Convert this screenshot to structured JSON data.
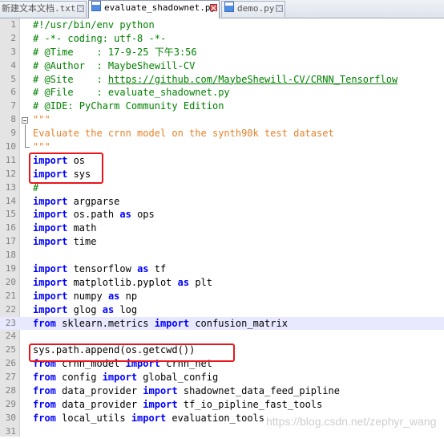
{
  "tabs": [
    {
      "label": "新建文本文档.txt",
      "active": false
    },
    {
      "label": "evaluate_shadownet.py",
      "active": true
    },
    {
      "label": "demo.py",
      "active": false
    }
  ],
  "lines": [
    {
      "n": "1",
      "tokens": [
        [
          "c-comment",
          "#!/usr/bin/env python"
        ]
      ]
    },
    {
      "n": "2",
      "tokens": [
        [
          "c-comment",
          "# -*- coding: utf-8 -*-"
        ]
      ]
    },
    {
      "n": "3",
      "tokens": [
        [
          "c-comment",
          "# @Time    : 17-9-25 下午3:56"
        ]
      ]
    },
    {
      "n": "4",
      "tokens": [
        [
          "c-comment",
          "# @Author  : MaybeShewill-CV"
        ]
      ]
    },
    {
      "n": "5",
      "tokens": [
        [
          "c-comment",
          "# @Site    : "
        ],
        [
          "c-link",
          "https://github.com/MaybeShewill-CV/CRNN_Tensorflow"
        ]
      ]
    },
    {
      "n": "6",
      "tokens": [
        [
          "c-comment",
          "# @File    : evaluate_shadownet.py"
        ]
      ]
    },
    {
      "n": "7",
      "tokens": [
        [
          "c-comment",
          "# @IDE: PyCharm Community Edition"
        ]
      ]
    },
    {
      "n": "8",
      "tokens": [
        [
          "c-string",
          "\"\"\""
        ]
      ]
    },
    {
      "n": "9",
      "tokens": [
        [
          "c-string",
          "Evaluate the crnn model on the synth90k test dataset"
        ]
      ]
    },
    {
      "n": "10",
      "tokens": [
        [
          "c-string",
          "\"\"\""
        ]
      ]
    },
    {
      "n": "11",
      "tokens": [
        [
          "c-kw",
          "import"
        ],
        [
          "",
          " os"
        ]
      ]
    },
    {
      "n": "12",
      "tokens": [
        [
          "c-kw",
          "import"
        ],
        [
          "",
          " sys"
        ]
      ]
    },
    {
      "n": "13",
      "tokens": [
        [
          "c-comment",
          "#"
        ]
      ]
    },
    {
      "n": "14",
      "tokens": [
        [
          "c-kw",
          "import"
        ],
        [
          "",
          " argparse"
        ]
      ]
    },
    {
      "n": "15",
      "tokens": [
        [
          "c-kw",
          "import"
        ],
        [
          "",
          " os.path "
        ],
        [
          "c-kw",
          "as"
        ],
        [
          "",
          " ops"
        ]
      ]
    },
    {
      "n": "16",
      "tokens": [
        [
          "c-kw",
          "import"
        ],
        [
          "",
          " math"
        ]
      ]
    },
    {
      "n": "17",
      "tokens": [
        [
          "c-kw",
          "import"
        ],
        [
          "",
          " time"
        ]
      ]
    },
    {
      "n": "18",
      "tokens": []
    },
    {
      "n": "19",
      "tokens": [
        [
          "c-kw",
          "import"
        ],
        [
          "",
          " tensorflow "
        ],
        [
          "c-kw",
          "as"
        ],
        [
          "",
          " tf"
        ]
      ]
    },
    {
      "n": "20",
      "tokens": [
        [
          "c-kw",
          "import"
        ],
        [
          "",
          " matplotlib.pyplot "
        ],
        [
          "c-kw",
          "as"
        ],
        [
          "",
          " plt"
        ]
      ]
    },
    {
      "n": "21",
      "tokens": [
        [
          "c-kw",
          "import"
        ],
        [
          "",
          " numpy "
        ],
        [
          "c-kw",
          "as"
        ],
        [
          "",
          " np"
        ]
      ]
    },
    {
      "n": "22",
      "tokens": [
        [
          "c-kw",
          "import"
        ],
        [
          "",
          " glog "
        ],
        [
          "c-kw",
          "as"
        ],
        [
          "",
          " log"
        ]
      ]
    },
    {
      "n": "23",
      "tokens": [
        [
          "c-kw",
          "from"
        ],
        [
          "",
          " sklearn.metrics "
        ],
        [
          "c-kw",
          "import"
        ],
        [
          "",
          " confusion_matrix"
        ]
      ]
    },
    {
      "n": "24",
      "tokens": []
    },
    {
      "n": "25",
      "tokens": [
        [
          "",
          "sys.path.append(os.getcwd())"
        ]
      ]
    },
    {
      "n": "26",
      "tokens": [
        [
          "c-kw",
          "from"
        ],
        [
          "",
          " crnn_model "
        ],
        [
          "c-kw",
          "import"
        ],
        [
          "",
          " crnn_net"
        ]
      ]
    },
    {
      "n": "27",
      "tokens": [
        [
          "c-kw",
          "from"
        ],
        [
          "",
          " config "
        ],
        [
          "c-kw",
          "import"
        ],
        [
          "",
          " global_config"
        ]
      ]
    },
    {
      "n": "28",
      "tokens": [
        [
          "c-kw",
          "from"
        ],
        [
          "",
          " data_provider "
        ],
        [
          "c-kw",
          "import"
        ],
        [
          "",
          " shadownet_data_feed_pipline"
        ]
      ]
    },
    {
      "n": "29",
      "tokens": [
        [
          "c-kw",
          "from"
        ],
        [
          "",
          " data_provider "
        ],
        [
          "c-kw",
          "import"
        ],
        [
          "",
          " tf_io_pipline_fast_tools"
        ]
      ]
    },
    {
      "n": "30",
      "tokens": [
        [
          "c-kw",
          "from"
        ],
        [
          "",
          " local_utils "
        ],
        [
          "c-kw",
          "import"
        ],
        [
          "",
          " evaluation_tools"
        ]
      ]
    },
    {
      "n": "31",
      "tokens": []
    }
  ],
  "highlighted_line": "23",
  "watermark": "https://blog.csdn.net/zephyr_wang",
  "colors": {
    "comment": "#008000",
    "string": "#e5822a",
    "keyword": "#0000ff",
    "annotation": "#e8161c"
  }
}
